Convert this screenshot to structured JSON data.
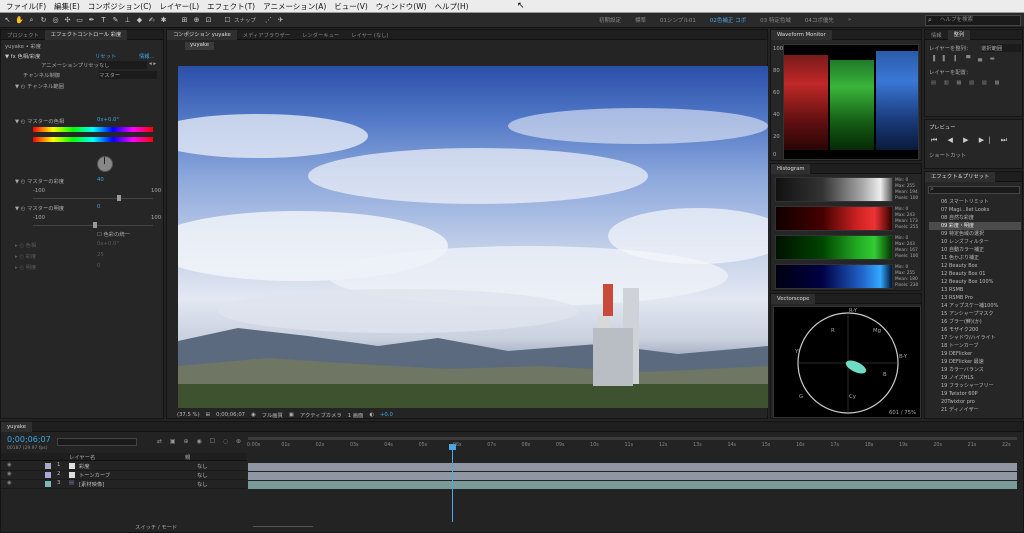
{
  "menu": [
    "ファイル(F)",
    "編集(E)",
    "コンポジション(C)",
    "レイヤー(L)",
    "エフェクト(T)",
    "アニメーション(A)",
    "ビュー(V)",
    "ウィンドウ(W)",
    "ヘルプ(H)"
  ],
  "toolbar": {
    "snap": "スナップ",
    "workspaces": [
      "初期設定",
      "標準",
      "01シンプル01",
      "02色補正 コポ",
      "03 特定色域",
      "04コポ優先"
    ],
    "active_workspace_index": 4,
    "search_placeholder": "ヘルプを検索"
  },
  "left_panel": {
    "tabs": [
      "プロジェクト",
      "エフェクトコントロール 彩度"
    ],
    "layer": "yuyake • 彩度",
    "fx_name": "色相/彩度",
    "reset": "リセット",
    "info": "情報...",
    "anim_preset_label": "アニメーションプリセット",
    "anim_preset_value": "なし",
    "channel_ctrl_label": "チャンネル制御",
    "channel_ctrl_value": "マスター",
    "channel_range": "チャンネル範囲",
    "master_hue": "マスターの色相",
    "master_hue_value": "0x+0.0°",
    "master_sat": "マスターの彩度",
    "master_sat_value": "40",
    "sat_min": "-100",
    "sat_max": "100",
    "master_light": "マスターの明度",
    "master_light_value": "0",
    "light_min": "-100",
    "light_max": "100",
    "colorize": "色彩の統一",
    "hue": "色相",
    "hue_value": "0x+0.0°",
    "saturation": "彩度",
    "saturation_value": "25",
    "lightness": "明度",
    "lightness_value": "0"
  },
  "composition": {
    "tabs": [
      "コンポジション yuyake",
      "メディアブラウザー",
      "レンダーキュー",
      "レイヤー (なし)"
    ],
    "comp_tab": "yuyake",
    "zoom": "(37.5 %)",
    "timecode": "0;00;06;07",
    "quality": "フル画質",
    "camera": "アクティブカメラ",
    "view": "1 画面",
    "offset": "+0.0"
  },
  "scopes": {
    "waveform_title": "Waveform Monitor",
    "waveform_labels": [
      "100",
      "80",
      "60",
      "40",
      "20",
      "0"
    ],
    "histogram_title": "Histogram",
    "hist_stats": [
      [
        "Min: 0",
        "Max: 255",
        "Mean: 194",
        "Pixels: 100"
      ],
      [
        "Min: 0",
        "Max: 243",
        "Mean: 173",
        "Pixels: 255"
      ],
      [
        "Min: 0",
        "Max: 243",
        "Mean: 167",
        "Pixels: 100"
      ],
      [
        "Min: 0",
        "Max: 255",
        "Mean: 180",
        "Pixels: 230"
      ]
    ],
    "vectorscope_title": "Vectorscope",
    "vector_labels": [
      "R-Y",
      "R",
      "Mg",
      "B-Y",
      "B",
      "Cy",
      "G",
      "Yl"
    ],
    "vector_footer": "601 / 75%"
  },
  "right_panel": {
    "tabs": [
      "情報",
      "整列"
    ],
    "align_layers": "レイヤーを整列：",
    "align_target": "選択範囲",
    "distribute": "レイヤーを配置：",
    "preview": "プレビュー",
    "shortcut": "ショートカット",
    "effects_title": "エフェクト＆プリセット",
    "effects": [
      "06 スマートリミット",
      "07 Magi...llet Looks",
      "08 自然な彩度",
      "09 彩度・明度",
      "09 特定色域の選択",
      "10 レンズフィルター",
      "10 自動カラー補正",
      "11 色かぶり補正",
      "12 Beauty Box",
      "12 Beauty Box 01",
      "12 Beauty Box 100%",
      "13 RSMB",
      "13 RSMB Pro",
      "14 アップスケー補100%",
      "15 アンシャープマスク",
      "16 ブラー(鮮)(か)",
      "16 モザイク200",
      "17 シャドウ/ハイライト",
      "18 トーンカーブ",
      "19 DEFlicker",
      "19 DEFlicker 最速",
      "19 カラーバランス",
      "19 ノイズHLS",
      "19 フラッシャーフリー",
      "19 Twixtor 60P",
      "20Twixtor pro",
      "21 ディノイザー"
    ]
  },
  "timeline": {
    "tab": "yuyake",
    "timecode": "0;00;06;07",
    "frames": "00187 (29.97 fps)",
    "col_layer": "レイヤー名",
    "col_parent": "親",
    "layers": [
      {
        "num": "1",
        "name": "彩度",
        "parent": "なし"
      },
      {
        "num": "2",
        "name": "トーンカーブ",
        "parent": "なし"
      },
      {
        "num": "3",
        "name": "[素材映像]",
        "parent": "なし"
      }
    ],
    "switch_mode": "スイッチ / モード",
    "ruler": [
      "0:00s",
      "01s",
      "02s",
      "03s",
      "04s",
      "05s",
      "06s",
      "07s",
      "08s",
      "09s",
      "10s",
      "11s",
      "12s",
      "13s",
      "14s",
      "15s",
      "16s",
      "17s",
      "18s",
      "19s",
      "20s",
      "21s",
      "22s"
    ]
  }
}
